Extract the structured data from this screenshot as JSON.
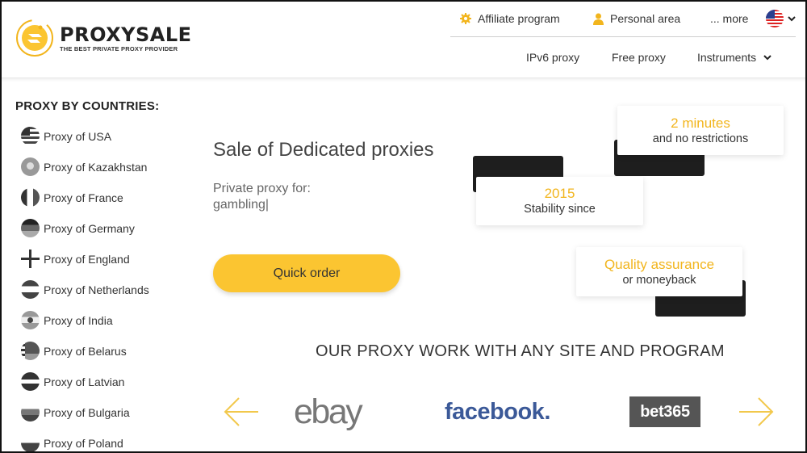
{
  "brand": {
    "name": "PROXYSALE",
    "tagline": "THE BEST PRIVATE PROXY PROVIDER"
  },
  "top_links": {
    "affiliate": "Affiliate program",
    "personal": "Personal area",
    "more": "... more"
  },
  "nav": {
    "ipv6": "IPv6 proxy",
    "free": "Free proxy",
    "instruments": "Instruments"
  },
  "sidebar": {
    "title": "PROXY BY COUNTRIES:",
    "items": [
      {
        "label": "Proxy of USA",
        "icon": "usa-flag-icon"
      },
      {
        "label": "Proxy of Kazakhstan",
        "icon": "kazakhstan-flag-icon"
      },
      {
        "label": "Proxy of France",
        "icon": "france-flag-icon"
      },
      {
        "label": "Proxy of Germany",
        "icon": "germany-flag-icon"
      },
      {
        "label": "Proxy of England",
        "icon": "england-flag-icon"
      },
      {
        "label": "Proxy of Netherlands",
        "icon": "netherlands-flag-icon"
      },
      {
        "label": "Proxy of India",
        "icon": "india-flag-icon"
      },
      {
        "label": "Proxy of Belarus",
        "icon": "belarus-flag-icon"
      },
      {
        "label": "Proxy of Latvian",
        "icon": "latvia-flag-icon"
      },
      {
        "label": "Proxy of Bulgaria",
        "icon": "bulgaria-flag-icon"
      },
      {
        "label": "Proxy of Poland",
        "icon": "poland-flag-icon"
      }
    ]
  },
  "hero": {
    "title": "Sale of Dedicated proxies",
    "subtitle": "Private proxy for:",
    "typed": "gambling|",
    "cta": "Quick order"
  },
  "cards": {
    "minutes": {
      "big": "2 minutes",
      "small": "and no restrictions"
    },
    "since": {
      "big": "2015",
      "small": "Stability since"
    },
    "quality": {
      "big": "Quality assurance",
      "small": "or moneyback"
    }
  },
  "partners": {
    "title": "OUR PROXY WORK WITH ANY SITE AND PROGRAM",
    "logos": [
      "ebay",
      "facebook.",
      "bet365"
    ]
  },
  "colors": {
    "accent": "#fbc531",
    "accent_text": "#f2b51d",
    "dark": "#1e1e1e",
    "facebook": "#3b5998",
    "bet365_bg": "#555555"
  }
}
